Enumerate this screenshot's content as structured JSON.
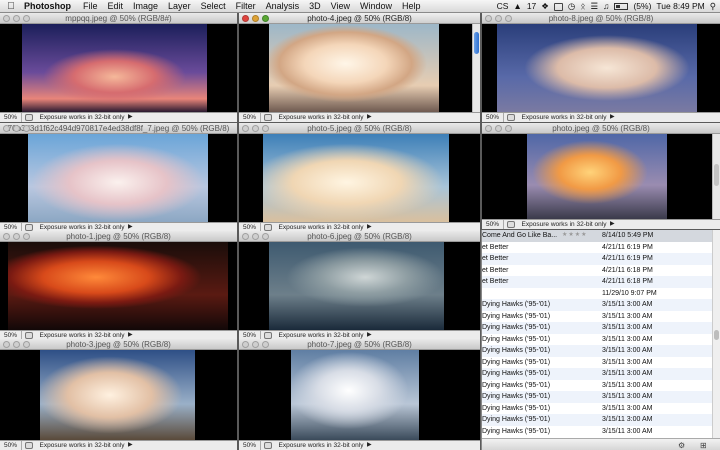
{
  "menubar": {
    "app_name": "Photoshop",
    "items": [
      "File",
      "Edit",
      "Image",
      "Layer",
      "Select",
      "Filter",
      "Analysis",
      "3D",
      "View",
      "Window",
      "Help"
    ],
    "status": {
      "cs": "CS",
      "count": "17",
      "battery": "(5%)",
      "clock": "Tue 8:49 PM"
    }
  },
  "windows": [
    {
      "title": "mppqq.jpeg @ 50% (RGB/8#)",
      "zoom": "50%",
      "status": "Exposure works in 32-bit only"
    },
    {
      "title": "photo-4.jpeg @ 50% (RGB/8)",
      "zoom": "50%",
      "status": "Exposure works in 32-bit only"
    },
    {
      "title": "photo-8.jpeg @ 50% (RGB/8)",
      "zoom": "50%",
      "status": "Exposure works in 32-bit only"
    },
    {
      "title": "70b3d3d1f62c494d970817e4ed38df8f_7.jpeg @ 50% (RGB/8)",
      "zoom": "50%",
      "status": "Exposure works in 32-bit only"
    },
    {
      "title": "photo-5.jpeg @ 50% (RGB/8)",
      "zoom": "50%",
      "status": "Exposure works in 32-bit only"
    },
    {
      "title": "photo.jpeg @ 50% (RGB/8)",
      "zoom": "50%",
      "status": "Exposure works in 32-bit only"
    },
    {
      "title": "photo-1.jpeg @ 50% (RGB/8)",
      "zoom": "50%",
      "status": "Exposure works in 32-bit only"
    },
    {
      "title": "photo-6.jpeg @ 50% (RGB/8)",
      "zoom": "50%",
      "status": "Exposure works in 32-bit only"
    },
    {
      "title": "photo-3.jpeg @ 50% (RGB/8)",
      "zoom": "50%",
      "status": "Exposure works in 32-bit only"
    },
    {
      "title": "photo-7.jpeg @ 50% (RGB/8)",
      "zoom": "50%",
      "status": "Exposure works in 32-bit only"
    }
  ],
  "list": {
    "rows": [
      {
        "song": "Come And Go Like Ba...",
        "date": "8/14/10 5:49 PM",
        "stars": "★★★★"
      },
      {
        "song": "et Better",
        "date": "4/21/11 6:19 PM"
      },
      {
        "song": "et Better",
        "date": "4/21/11 6:19 PM"
      },
      {
        "song": "et Better",
        "date": "4/21/11 6:18 PM"
      },
      {
        "song": "et Better",
        "date": "4/21/11 6:18 PM"
      },
      {
        "song": "",
        "date": "11/29/10 9:07 PM"
      },
      {
        "song": "Dying Hawks ('95-'01)",
        "date": "3/15/11 3:00 AM"
      },
      {
        "song": "Dying Hawks ('95-'01)",
        "date": "3/15/11 3:00 AM"
      },
      {
        "song": "Dying Hawks ('95-'01)",
        "date": "3/15/11 3:00 AM"
      },
      {
        "song": "Dying Hawks ('95-'01)",
        "date": "3/15/11 3:00 AM"
      },
      {
        "song": "Dying Hawks ('95-'01)",
        "date": "3/15/11 3:00 AM"
      },
      {
        "song": "Dying Hawks ('95-'01)",
        "date": "3/15/11 3:00 AM"
      },
      {
        "song": "Dying Hawks ('95-'01)",
        "date": "3/15/11 3:00 AM"
      },
      {
        "song": "Dying Hawks ('95-'01)",
        "date": "3/15/11 3:00 AM"
      },
      {
        "song": "Dying Hawks ('95-'01)",
        "date": "3/15/11 3:00 AM"
      },
      {
        "song": "Dying Hawks ('95-'01)",
        "date": "3/15/11 3:00 AM"
      },
      {
        "song": "Dying Hawks ('95-'01)",
        "date": "3/15/11 3:00 AM"
      },
      {
        "song": "Dying Hawks ('95-'01)",
        "date": "3/15/11 3:00 AM"
      }
    ]
  }
}
